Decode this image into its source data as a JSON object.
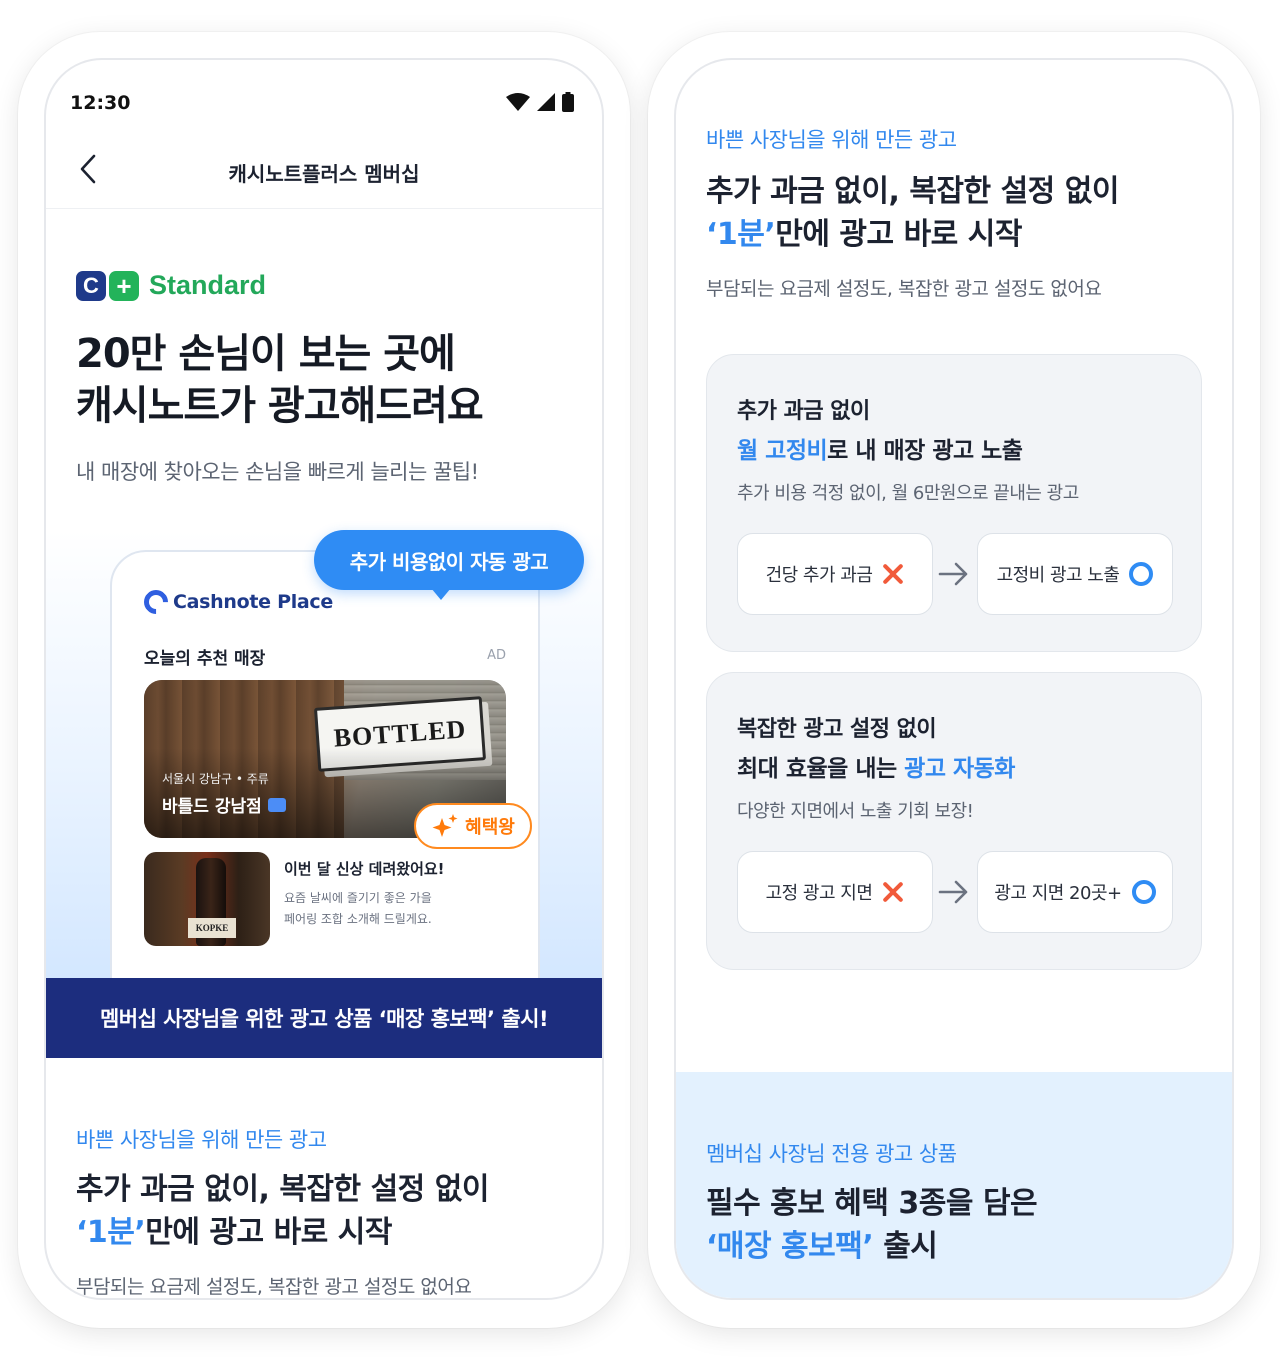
{
  "left_phone": {
    "status_bar": {
      "time": "12:30"
    },
    "header": {
      "title": "캐시노트플러스 멤버십"
    },
    "plan": {
      "logo_c": "C",
      "logo_plus": "+",
      "name": "Standard"
    },
    "hero": {
      "title_line1": "20만 손님이 보는 곳에",
      "title_line2": "캐시노트가 광고해드려요",
      "subtitle": "내 매장에 찾아오는 손님을 빠르게 늘리는 꿀팁!"
    },
    "tooltip": "추가 비용없이 자동 광고",
    "mock_app": {
      "brand": "Cashnote Place",
      "section_title": "오늘의 추천 매장",
      "ad_label": "AD",
      "store": {
        "sign": "BOTTLED",
        "meta": "서울시 강남구 • 주류",
        "name": "바틀드 강남점"
      },
      "benefit_badge": "혜택왕",
      "feed": {
        "bottle_label": "KOPKE",
        "title": "이번 달 신상 데려왔어요!",
        "desc_line1": "요즘 날씨에 즐기기 좋은 가을",
        "desc_line2": "페어링 조합 소개해 드릴게요."
      }
    },
    "banner": "멤버십 사장님을 위한 광고 상품 ‘매장 홍보팩’ 출시!",
    "section": {
      "eyebrow": "바쁜 사장님을 위해 만든 광고",
      "heading_line1": "추가 과금 없이, 복잡한 설정 없이",
      "heading_hl": "‘1분’",
      "heading_rest": "만에 광고 바로 시작",
      "desc": "부담되는 요금제 설정도, 복잡한 광고 설정도 없어요"
    }
  },
  "right_phone": {
    "section": {
      "eyebrow": "바쁜 사장님을 위해 만든 광고",
      "heading_line1": "추가 과금 없이, 복잡한 설정 없이",
      "heading_hl": "‘1분’",
      "heading_rest": "만에 광고 바로 시작",
      "desc": "부담되는 요금제 설정도, 복잡한 광고 설정도 없어요"
    },
    "cards": [
      {
        "line1": "추가 과금 없이",
        "line2_hl": "월 고정비",
        "line2_rest": "로 내 매장 광고 노출",
        "desc": "추가 비용 걱정 없이, 월 6만원으로 끝내는 광고",
        "before": "건당 추가 과금",
        "after": "고정비 광고 노출"
      },
      {
        "line1": "복잡한 광고 설정 없이",
        "line2_pre": "최대 효율을 내는 ",
        "line2_hl": "광고 자동화",
        "desc": "다양한 지면에서 노출 기회 보장!",
        "before": "고정 광고 지면",
        "after": "광고 지면 20곳+"
      }
    ],
    "bottom": {
      "eyebrow": "멤버십 사장님 전용 광고 상품",
      "heading_line1": "필수 홍보 혜택 3종을 담은",
      "heading_hl": "‘매장 홍보팩’",
      "heading_rest": " 출시"
    }
  },
  "colors": {
    "accent": "#3288ee",
    "banner": "#1c2d7e",
    "plan_green": "#23a85a",
    "benefit_orange": "#ff7a0a",
    "x_red": "#f15a3a"
  }
}
